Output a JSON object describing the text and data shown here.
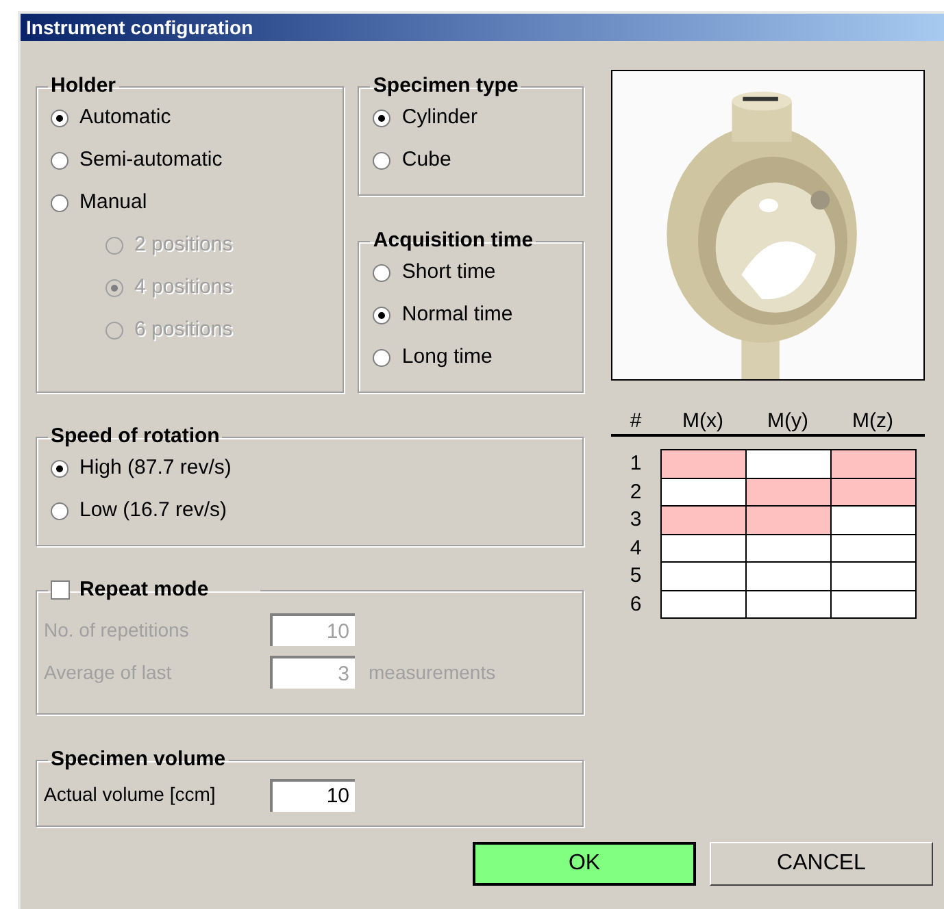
{
  "window": {
    "title": "Instrument configuration"
  },
  "holder": {
    "title": "Holder",
    "options": [
      {
        "label": "Automatic",
        "selected": true,
        "disabled": false
      },
      {
        "label": "Semi-automatic",
        "selected": false,
        "disabled": false
      },
      {
        "label": "Manual",
        "selected": false,
        "disabled": false,
        "children": [
          {
            "label": "2 positions",
            "selected": false,
            "disabled": true
          },
          {
            "label": "4 positions",
            "selected": true,
            "disabled": true
          },
          {
            "label": "6 positions",
            "selected": false,
            "disabled": true
          }
        ]
      }
    ]
  },
  "specimen_type": {
    "title": "Specimen type",
    "options": [
      {
        "label": "Cylinder",
        "selected": true,
        "disabled": false
      },
      {
        "label": "Cube",
        "selected": false,
        "disabled": false
      }
    ]
  },
  "acquisition_time": {
    "title": "Acquisition time",
    "options": [
      {
        "label": "Short time",
        "selected": false,
        "disabled": false
      },
      {
        "label": "Normal time",
        "selected": true,
        "disabled": false
      },
      {
        "label": "Long time",
        "selected": false,
        "disabled": false
      }
    ]
  },
  "speed_of_rotation": {
    "title": "Speed of rotation",
    "options": [
      {
        "label": "High (87.7 rev/s)",
        "selected": true,
        "disabled": false
      },
      {
        "label": "Low (16.7 rev/s)",
        "selected": false,
        "disabled": false
      }
    ]
  },
  "repeat_mode": {
    "title": "Repeat mode",
    "checked": false,
    "fields": [
      {
        "label": "No. of repetitions",
        "value": "10",
        "disabled": true
      },
      {
        "label": "Average of last",
        "value": "3",
        "suffix": "measurements",
        "disabled": true
      }
    ]
  },
  "specimen_volume": {
    "title": "Specimen volume",
    "fields": [
      {
        "label": "Actual volume [ccm]",
        "value": "10",
        "disabled": false
      }
    ]
  },
  "table": {
    "columns": [
      "#",
      "M(x)",
      "M(y)",
      "M(z)"
    ],
    "rows": [
      {
        "label": "1",
        "marked": [
          true,
          false,
          true
        ]
      },
      {
        "label": "2",
        "marked": [
          false,
          true,
          true
        ]
      },
      {
        "label": "3",
        "marked": [
          true,
          true,
          false
        ]
      },
      {
        "label": "4",
        "marked": [
          false,
          false,
          false
        ]
      },
      {
        "label": "5",
        "marked": [
          false,
          false,
          false
        ]
      },
      {
        "label": "6",
        "marked": [
          false,
          false,
          false
        ]
      }
    ]
  },
  "buttons": [
    {
      "label": "OK",
      "kind": "primary"
    },
    {
      "label": "CANCEL",
      "kind": "normal"
    }
  ]
}
